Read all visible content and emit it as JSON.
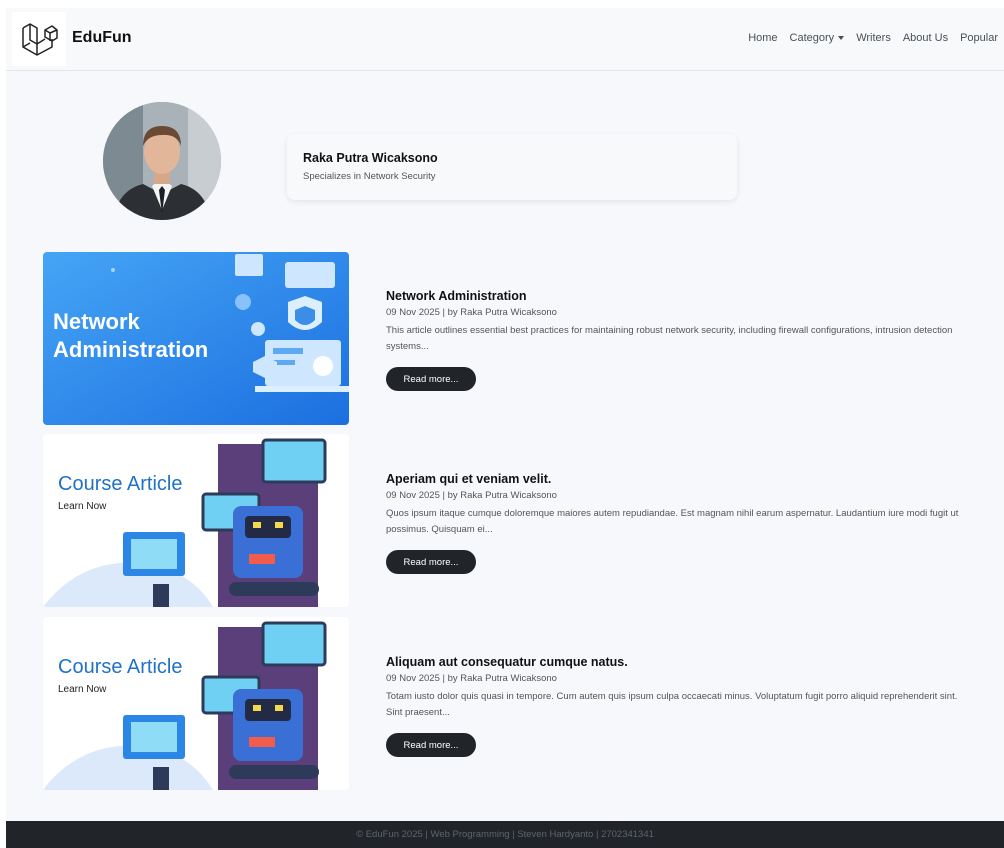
{
  "brand": "EduFun",
  "nav": {
    "home": "Home",
    "category": "Category",
    "writers": "Writers",
    "about": "About Us",
    "popular": "Popular"
  },
  "writer": {
    "name": "Raka Putra Wicaksono",
    "specialty": "Specializes in Network Security"
  },
  "articles": [
    {
      "thumb_line1": "Network",
      "thumb_line2": "Administration",
      "title": "Network Administration",
      "meta": "09 Nov 2025 | by Raka Putra Wicaksono",
      "excerpt": "This article outlines essential best practices for maintaining robust network security, including firewall configurations, intrusion detection systems...",
      "button": "Read more..."
    },
    {
      "thumb_title": "Course Article",
      "thumb_sub": "Learn Now",
      "title": "Aperiam qui et veniam velit.",
      "meta": "09 Nov 2025 | by Raka Putra Wicaksono",
      "excerpt": "Quos ipsum itaque cumque doloremque maiores autem repudiandae. Est magnam nihil earum aspernatur. Laudantium iure modi fugit ut possimus. Quisquam ei...",
      "button": "Read more..."
    },
    {
      "thumb_title": "Course Article",
      "thumb_sub": "Learn Now",
      "title": "Aliquam aut consequatur cumque natus.",
      "meta": "09 Nov 2025 | by Raka Putra Wicaksono",
      "excerpt": "Totam iusto dolor quis quasi in tempore. Cum autem quis ipsum culpa occaecati minus. Voluptatum fugit porro aliquid reprehenderit sint. Sint praesent...",
      "button": "Read more..."
    }
  ],
  "footer": "© EduFun 2025 | Web Programming | Steven Hardyanto | 2702341341",
  "colors": {
    "page_bg": "#f6f8fb",
    "dark": "#212529",
    "network_blue": "#2f8ff0",
    "course_blue": "#1f72c4"
  },
  "icons": [
    "laravel-logo-icon",
    "caret-down-icon"
  ]
}
